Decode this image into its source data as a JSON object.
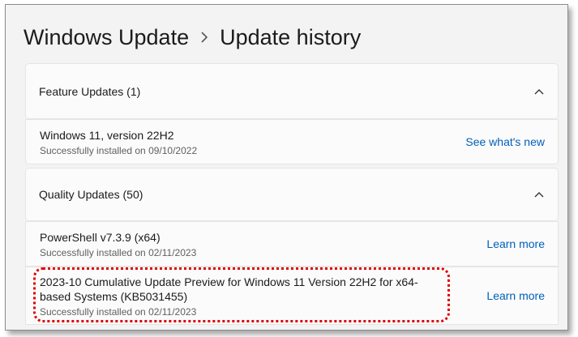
{
  "breadcrumb": {
    "parent": "Windows Update",
    "current": "Update history"
  },
  "feature_updates": {
    "header": "Feature Updates (1)",
    "items": [
      {
        "title": "Windows 11, version 22H2",
        "status": "Successfully installed on 09/10/2022",
        "link": "See what's new"
      }
    ]
  },
  "quality_updates": {
    "header": "Quality Updates (50)",
    "items": [
      {
        "title": "PowerShell v7.3.9 (x64)",
        "status": "Successfully installed on 02/11/2023",
        "link": "Learn more"
      },
      {
        "title": "2023-10 Cumulative Update Preview for Windows 11 Version 22H2 for x64-based Systems (KB5031455)",
        "status": "Successfully installed on 02/11/2023",
        "link": "Learn more"
      }
    ]
  },
  "colors": {
    "accent_link": "#005fb8",
    "highlight": "#e00000"
  },
  "icons": {
    "breadcrumb_separator": "chevron-right-icon",
    "section_toggle": "chevron-up-icon"
  }
}
